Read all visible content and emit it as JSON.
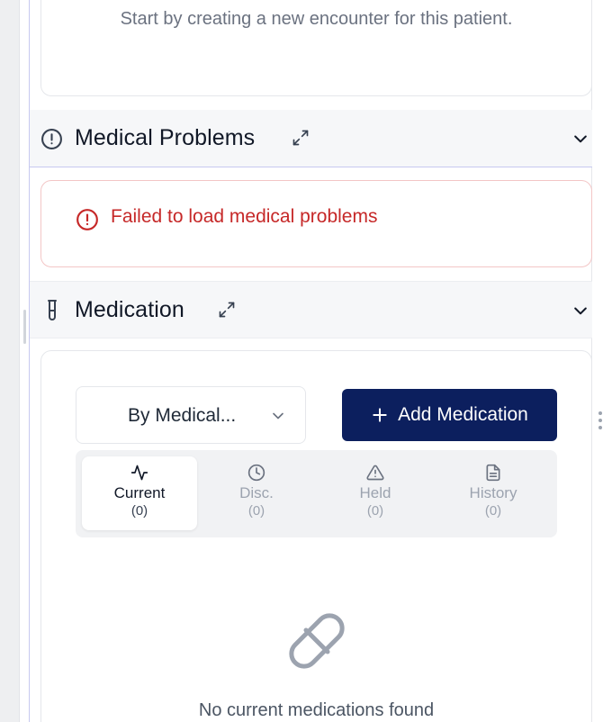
{
  "encounter": {
    "empty_message": "Start by creating a new encounter for this patient."
  },
  "medical_problems": {
    "title": "Medical Problems",
    "error": "Failed to load medical problems",
    "icons": {
      "section": "alert-circle-icon",
      "expand": "expand-icon",
      "collapse": "chevron-down-icon"
    }
  },
  "medication": {
    "title": "Medication",
    "icons": {
      "section": "test-tube-icon",
      "expand": "expand-icon",
      "collapse": "chevron-down-icon"
    },
    "group_select": {
      "value": "By Medical..."
    },
    "add_button": {
      "label": "Add Medication"
    },
    "tabs": [
      {
        "label": "Current",
        "count": "(0)",
        "icon": "activity-icon",
        "active": true
      },
      {
        "label": "Disc.",
        "count": "(0)",
        "icon": "clock-icon",
        "active": false
      },
      {
        "label": "Held",
        "count": "(0)",
        "icon": "alert-triangle-icon",
        "active": false
      },
      {
        "label": "History",
        "count": "(0)",
        "icon": "file-text-icon",
        "active": false
      }
    ],
    "empty_message": "No current medications found",
    "empty_icon": "pill-icon"
  },
  "colors": {
    "primary": "#0c1f5e",
    "error": "#c62828",
    "muted": "#9ca3af"
  }
}
